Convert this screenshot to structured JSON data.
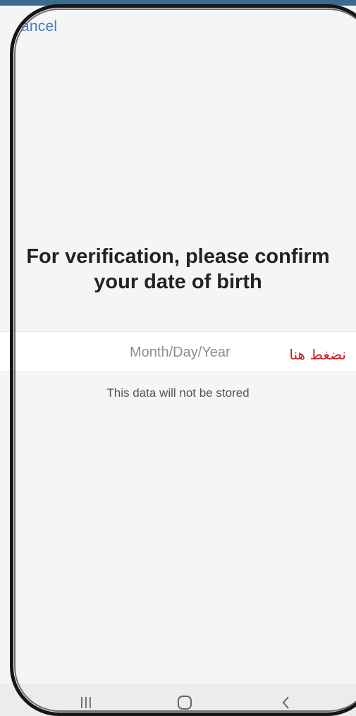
{
  "header": {
    "cancel_label": "ancel"
  },
  "main": {
    "title_line1": "For verification, please confirm",
    "title_line2": "your date of birth",
    "date_field": {
      "placeholder": "Month/Day/Year",
      "annotation": "نضغط هنا"
    },
    "hint": "This data will not be stored"
  },
  "nav": {
    "recents_icon": "recents-icon",
    "home_icon": "home-icon",
    "back_icon": "back-icon"
  },
  "colors": {
    "link": "#3d7cc9",
    "annotation": "#d11a1a",
    "title": "#222222"
  }
}
